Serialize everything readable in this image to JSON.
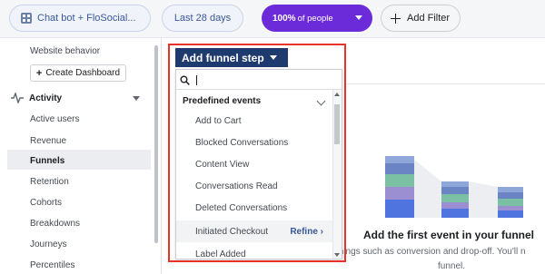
{
  "topbar": {
    "app_filter_label": "Chat bot + FloSocial...",
    "date_range_label": "Last 28 days",
    "people_percent": "100%",
    "people_suffix": "of people",
    "add_filter_label": "Add Filter"
  },
  "sidebar": {
    "website_behavior": "Website behavior",
    "create_dashboard": "Create Dashboard",
    "section_label": "Activity",
    "items": [
      {
        "label": "Active users"
      },
      {
        "label": "Revenue"
      },
      {
        "label": "Funnels"
      },
      {
        "label": "Retention"
      },
      {
        "label": "Cohorts"
      },
      {
        "label": "Breakdowns"
      },
      {
        "label": "Journeys"
      },
      {
        "label": "Percentiles"
      }
    ],
    "active_item": "Funnels"
  },
  "funnel_dropdown": {
    "button_label": "Add funnel step",
    "search_value": "",
    "group_label": "Predefined events",
    "items": [
      {
        "label": "Add to Cart"
      },
      {
        "label": "Blocked Conversations"
      },
      {
        "label": "Content View"
      },
      {
        "label": "Conversations Read"
      },
      {
        "label": "Deleted Conversations"
      },
      {
        "label": "Initiated Checkout",
        "action": "Refine"
      },
      {
        "label": "Label Added"
      }
    ],
    "hovered_item": "Initiated Checkout"
  },
  "main": {
    "empty_title": "Add the first event in your funnel",
    "empty_desc_line1": "things such as conversion and drop-off. You'll n",
    "empty_desc_line2": "funnel."
  },
  "colors": {
    "accent_purple": "#6c2bd9",
    "button_navy": "#1f3a6e",
    "highlight_red": "#e8332a",
    "link_blue": "#385898"
  },
  "icons": {
    "app": "app-grid-icon",
    "add_filter": "plus-icon",
    "activity": "pulse-icon",
    "search": "search-icon"
  }
}
